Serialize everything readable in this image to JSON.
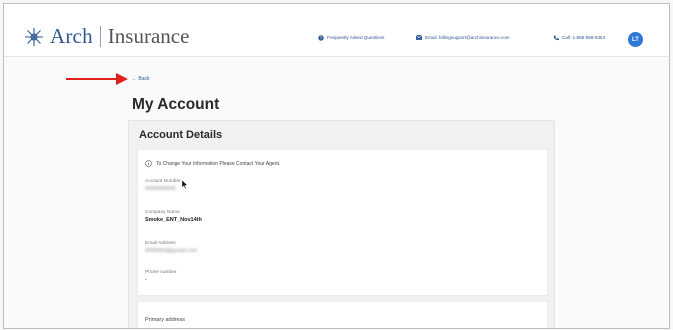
{
  "header": {
    "brand_name": "Arch",
    "brand_suffix": "Insurance",
    "links": {
      "faq": "Frequently Asked Questions",
      "email": "Email: billingsupport@archinsurance.com",
      "call": "Call: 1-855-559-8354"
    },
    "avatar_initials": "LT"
  },
  "nav": {
    "back_label": "← Back"
  },
  "page": {
    "title": "My Account"
  },
  "account_details": {
    "title": "Account Details",
    "notice": "To Change Your Information Please Contact Your Agent.",
    "fields": [
      {
        "label": "Account Number",
        "value": "0000000000",
        "obscured": true
      },
      {
        "label": "Company Name",
        "value": "Smoke_ENT_Nov14th",
        "obscured": false
      },
      {
        "label": "Email Address",
        "value": "0000000@gmail.com",
        "obscured": true
      },
      {
        "label": "Phone number",
        "value": "-",
        "obscured": false
      }
    ]
  },
  "primary_address": {
    "label": "Primary address"
  },
  "colors": {
    "brand_blue": "#2f5790",
    "avatar_blue": "#2f77d8",
    "annotation_red": "#e0201b"
  }
}
